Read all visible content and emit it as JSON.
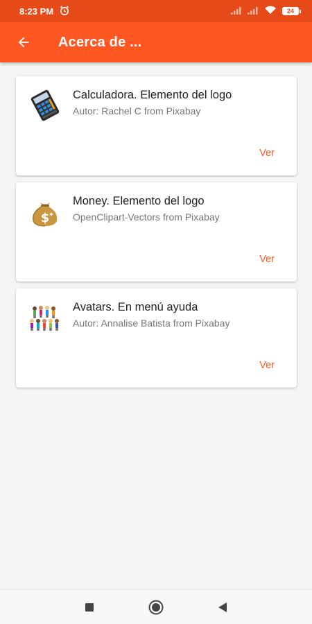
{
  "status_bar": {
    "time": "8:23 PM",
    "battery": "24",
    "icons": [
      "alarm-icon",
      "signal-icon",
      "signal-icon",
      "wifi-icon",
      "battery-icon"
    ]
  },
  "app_bar": {
    "title": "Acerca de ...",
    "back_icon": "arrow-back-icon"
  },
  "credits": [
    {
      "title": "Calculadora. Elemento del logo",
      "subtitle": "Autor: Rachel C from Pixabay",
      "action": "Ver",
      "icon": "calculator-icon"
    },
    {
      "title": "Money. Elemento del logo",
      "subtitle": "OpenClipart-Vectors from Pixabay",
      "action": "Ver",
      "icon": "money-bag-icon"
    },
    {
      "title": "Avatars. En menú ayuda",
      "subtitle": "Autor: Annalise Batista from Pixabay",
      "action": "Ver",
      "icon": "avatars-icon"
    }
  ],
  "colors": {
    "primary": "#ff5722",
    "primary_dark": "#e64a19",
    "background": "#f4f4f4",
    "card": "#ffffff"
  },
  "nav_bar": {
    "icons": [
      "recents-square-icon",
      "home-circle-icon",
      "back-triangle-icon"
    ]
  }
}
